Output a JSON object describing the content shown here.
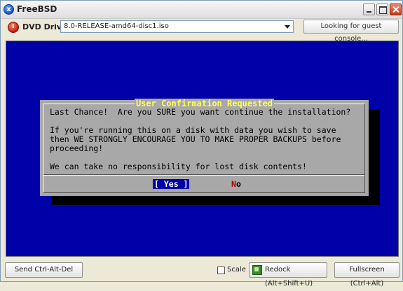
{
  "window": {
    "title": "FreeBSD"
  },
  "toolbar": {
    "dvd_label": "DVD Drive:",
    "dvd_value": "8.0-RELEASE-amd64-disc1.iso",
    "guest_status": "Looking for guest console..."
  },
  "dialog": {
    "title": "User Confirmation Requested",
    "lines": [
      "Last Chance!  Are you SURE you want continue the installation?",
      "If you're running this on a disk with data you wish to save",
      "then WE STRONGLY ENCOURAGE YOU TO MAKE PROPER BACKUPS before",
      "proceeding!",
      "We can take no responsibility for lost disk contents!"
    ],
    "yes_label": "[ Yes ]",
    "no_hotkey": "N",
    "no_rest": "o"
  },
  "bottom": {
    "ctrl_alt_del": "Send Ctrl-Alt-Del",
    "scale_label": "Scale",
    "scale_checked": false,
    "redock": "Redock (Alt+Shift+U)",
    "fullscreen": "Fullscreen (Ctrl+Alt)"
  },
  "colors": {
    "console_bg": "#0000a8",
    "dialog_bg": "#a8a8a8",
    "dialog_title": "#ffff55",
    "no_hotkey": "#a80000"
  }
}
